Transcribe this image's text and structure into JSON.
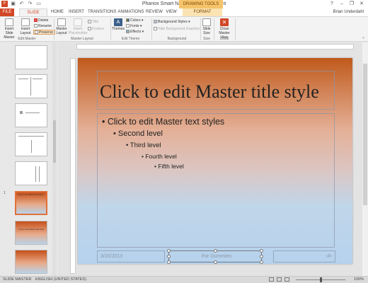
{
  "window": {
    "title": "Phanox Smart Navigator - PowerPoint",
    "contextual_tab_group": "DRAWING TOOLS",
    "controls": [
      "?",
      "–",
      "❐",
      "✕"
    ],
    "quick_access": [
      "save-icon",
      "undo-icon",
      "redo-icon",
      "present-icon"
    ]
  },
  "tabs": [
    {
      "label": "FILE"
    },
    {
      "label": "SLIDE MASTER"
    },
    {
      "label": "HOME"
    },
    {
      "label": "INSERT"
    },
    {
      "label": "TRANSITIONS"
    },
    {
      "label": "ANIMATIONS"
    },
    {
      "label": "REVIEW"
    },
    {
      "label": "VIEW"
    },
    {
      "label": "FORMAT"
    }
  ],
  "user": "Brian Underdahl",
  "ribbon": {
    "insert_slide_master": "Insert Slide Master",
    "insert_layout": "Insert Layout",
    "delete": "Delete",
    "rename": "Rename",
    "preserve": "Preserve",
    "master_layout": "Master Layout",
    "insert_placeholder": "Insert Placeholder",
    "title_chk": "Title",
    "footers_chk": "Footers",
    "themes": "Themes",
    "colors": "Colors",
    "fonts": "Fonts",
    "effects": "Effects",
    "background_styles": "Background Styles",
    "hide_bg_graphics": "Hide Background Graphics",
    "slide_size": "Slide Size",
    "close_master_view": "Close Master View",
    "groups": {
      "edit_master": "Edit Master",
      "master_layout": "Master Layout",
      "edit_theme": "Edit Theme",
      "background": "Background",
      "size": "Size",
      "close": "Close"
    }
  },
  "thumbnails": {
    "numbers": [
      "1"
    ],
    "selected_title": "Click to edit Master title style",
    "next_title": "Click to edit Master title style"
  },
  "slide": {
    "title": "Click to edit Master title style",
    "bullets": [
      {
        "text": "• Click to edit Master text styles",
        "level": 1
      },
      {
        "text": "• Second level",
        "level": 2
      },
      {
        "text": "• Third level",
        "level": 3
      },
      {
        "text": "• Fourth level",
        "level": 4
      },
      {
        "text": "• Fifth level",
        "level": 5
      }
    ],
    "date": "3/20/2013",
    "footer": "For Dummies",
    "slide_number": "‹#›"
  },
  "statusbar": {
    "view": "SLIDE MASTER",
    "language": "ENGLISH (UNITED STATES)",
    "zoom": "100%"
  },
  "colors": {
    "accent": "#d24726",
    "drawing_tools": "#f5c36b"
  }
}
